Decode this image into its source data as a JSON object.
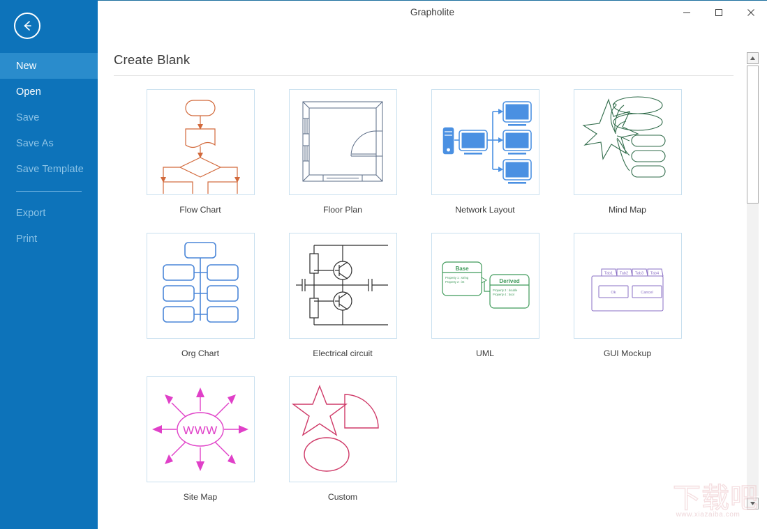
{
  "window": {
    "title": "Grapholite",
    "controls": [
      {
        "name": "minimize-button",
        "glyph": "minimize-icon"
      },
      {
        "name": "maximize-button",
        "glyph": "maximize-icon"
      },
      {
        "name": "close-button",
        "glyph": "close-icon"
      }
    ]
  },
  "sidebar": {
    "back_icon": "back-arrow-circle-icon",
    "accent_color": "#0d73ba",
    "selected_color": "#2a8ccc",
    "items": [
      {
        "label": "New",
        "state": "selected"
      },
      {
        "label": "Open",
        "state": "enabled"
      },
      {
        "label": "Save",
        "state": "disabled"
      },
      {
        "label": "Save As",
        "state": "disabled"
      },
      {
        "label": "Save Template",
        "state": "disabled"
      },
      {
        "label": "Export",
        "state": "disabled"
      },
      {
        "label": "Print",
        "state": "disabled"
      }
    ]
  },
  "main": {
    "page_title": "Create Blank",
    "templates": [
      {
        "label": "Flow Chart",
        "thumb": "flow-chart-thumbnail",
        "color": "#d2693b"
      },
      {
        "label": "Floor Plan",
        "thumb": "floor-plan-thumbnail",
        "color": "#5a6b86"
      },
      {
        "label": "Network Layout",
        "thumb": "network-layout-thumbnail",
        "color": "#4a90e2"
      },
      {
        "label": "Mind Map",
        "thumb": "mind-map-thumbnail",
        "color": "#2f6b49"
      },
      {
        "label": "Org Chart",
        "thumb": "org-chart-thumbnail",
        "color": "#4a86d8"
      },
      {
        "label": "Electrical circuit",
        "thumb": "electrical-circuit-thumbnail",
        "color": "#2b2b2b"
      },
      {
        "label": "UML",
        "thumb": "uml-thumbnail",
        "color": "#3f9a5a"
      },
      {
        "label": "GUI Mockup",
        "thumb": "gui-mockup-thumbnail",
        "color": "#8a6fc4"
      },
      {
        "label": "Site Map",
        "thumb": "site-map-thumbnail",
        "color": "#e040c8"
      },
      {
        "label": "Custom",
        "thumb": "custom-thumbnail",
        "color": "#cf3a68"
      }
    ],
    "uml_labels": {
      "base_title": "Base",
      "base_rows": [
        "Property 1 : string",
        "Property 2 : int"
      ],
      "derived_title": "Derived",
      "derived_rows": [
        "Property 3 : double",
        "Property 4 : bool"
      ]
    },
    "gui_labels": {
      "tabs": [
        "Tab1",
        "Tab2",
        "Tab3",
        "Tab4"
      ],
      "ok": "Ok",
      "cancel": "Cancel"
    },
    "site_map_label": "WWW"
  },
  "scrollbar": {
    "up_icon": "caret-up-icon",
    "down_icon": "caret-down-icon"
  },
  "watermark": {
    "text_cn": "下载吧",
    "url": "www.xiazaiba.com"
  }
}
